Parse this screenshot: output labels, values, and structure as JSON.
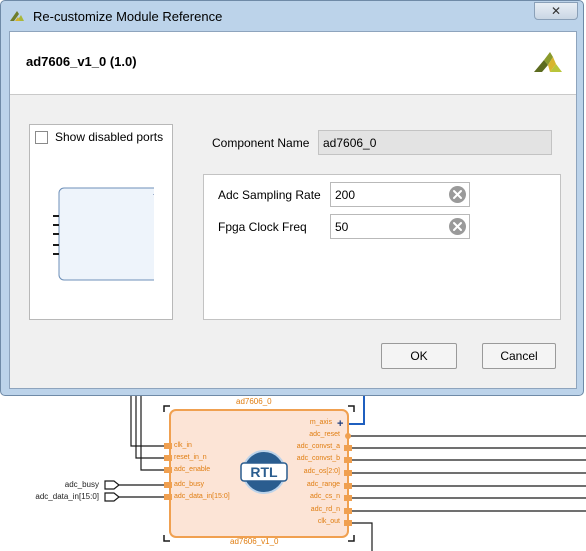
{
  "dialog": {
    "title": "Re-customize Module Reference",
    "close_label": "✕",
    "module_title": "ad7606_v1_0 (1.0)",
    "show_disabled_ports_label": "Show disabled ports",
    "show_disabled_ports_checked": false,
    "component_name_label": "Component Name",
    "component_name_value": "ad7606_0",
    "params": [
      {
        "label": "Adc Sampling Rate",
        "value": "200"
      },
      {
        "label": "Fpga Clock Freq",
        "value": "50"
      }
    ],
    "ok_label": "OK",
    "cancel_label": "Cancel"
  },
  "diagram": {
    "block_name_top": "ad7606_0",
    "block_name_bottom": "ad7606_v1_0",
    "rtl_label": "RTL",
    "left_ports": [
      "clk_in",
      "reset_in_n",
      "adc_enable",
      "adc_busy",
      "adc_data_in[15:0]"
    ],
    "right_ports": [
      "m_axis",
      "adc_reset",
      "adc_convst_a",
      "adc_convst_b",
      "adc_os[2:0]",
      "adc_range",
      "adc_cs_n",
      "adc_rd_n",
      "clk_out"
    ],
    "external_inputs": [
      "adc_busy",
      "adc_data_in[15:0]"
    ]
  },
  "colors": {
    "title_bar": "#bcd3ea",
    "block_fill": "#fce4d6",
    "block_border": "#f0a050",
    "port_text": "#e07d10",
    "rtl_badge": "#2a5d8f",
    "wire": "#1a1a1a",
    "axis_wire": "#1f5fbf"
  }
}
